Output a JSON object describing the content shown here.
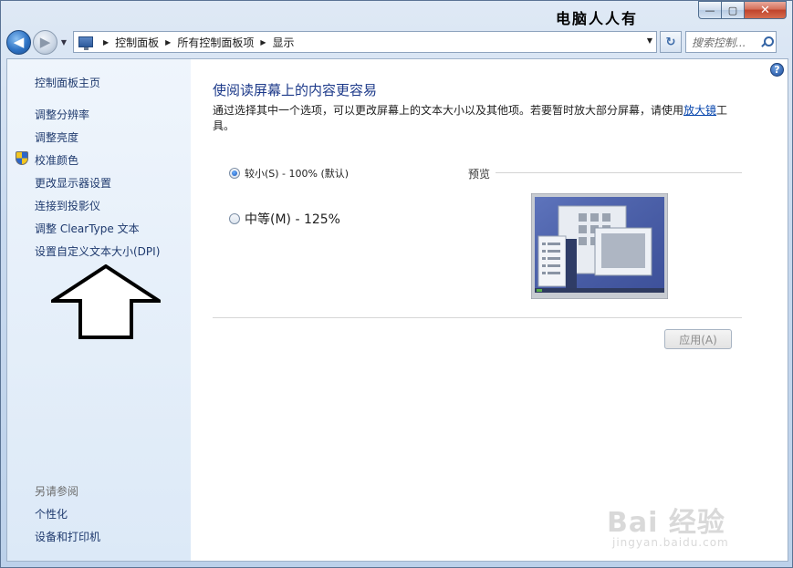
{
  "titlebar": {
    "overlay_text": "电脑人人有",
    "minimize_symbol": "—",
    "maximize_symbol": "▢",
    "close_symbol": "✕"
  },
  "navigation": {
    "back_symbol": "◀",
    "forward_symbol": "▶",
    "breadcrumbs": [
      "控制面板",
      "所有控制面板项",
      "显示"
    ],
    "search_placeholder": "搜索控制...",
    "refresh_symbol": "↻"
  },
  "sidebar": {
    "home": "控制面板主页",
    "items": [
      "调整分辨率",
      "调整亮度",
      "校准颜色",
      "更改显示器设置",
      "连接到投影仪",
      "调整 ClearType 文本",
      "设置自定义文本大小(DPI)"
    ],
    "see_also_heading": "另请参阅",
    "see_also_items": [
      "个性化",
      "设备和打印机"
    ]
  },
  "main": {
    "help_symbol": "?",
    "title": "使阅读屏幕上的内容更容易",
    "description_before_link": "通过选择其中一个选项，可以更改屏幕上的文本大小以及其他项。若要暂时放大部分屏幕，请使用",
    "magnifier_link": "放大镜",
    "description_after_link": "工具。",
    "options": [
      {
        "label": "较小(S) - 100% (默认)",
        "checked": true
      },
      {
        "label": "中等(M) - 125%",
        "checked": false
      }
    ],
    "preview_label": "预览",
    "apply_button": "应用(A)"
  },
  "watermark": {
    "main": "Bai 经验",
    "sub": "jingyan.baidu.com"
  },
  "colors": {
    "link": "#1f3a6e",
    "title": "#1d3a8a",
    "sidebar_top": "#eff5fc",
    "sidebar_bottom": "#dce9f7"
  }
}
